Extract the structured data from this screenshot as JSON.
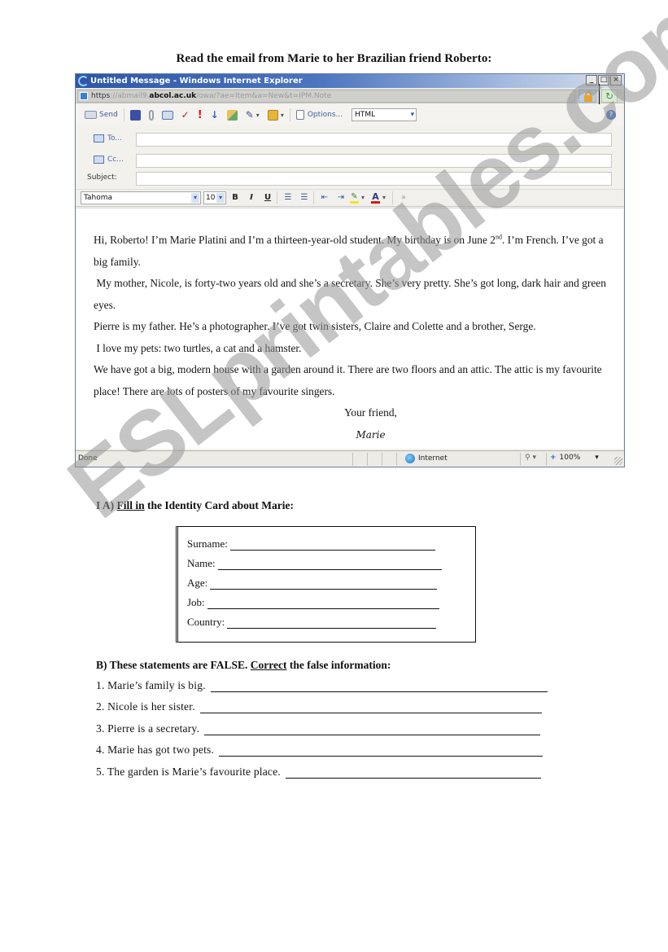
{
  "page_title": "Read the email from Marie to her Brazilian friend Roberto:",
  "browser": {
    "title": "Untitled Message - Windows Internet Explorer",
    "window_buttons": [
      "_",
      "□",
      "×"
    ],
    "address": {
      "scheme": "https",
      "prefix": "://abmail9.",
      "host": "abcol.ac.uk",
      "path": "/owa/?ae=Item&a=New&t=IPM.Note"
    },
    "refresh_glyph": "↻",
    "help_glyph": "?",
    "toolbar": {
      "send_label": "Send",
      "options_label": "Options...",
      "format_value": "HTML",
      "icons": [
        "save-icon",
        "attach-icon",
        "address-book-icon",
        "check-names-icon",
        "high-importance-icon",
        "low-importance-icon",
        "paste-icon",
        "spelling-icon",
        "flag-icon",
        "options-icon"
      ]
    },
    "header_fields": {
      "to_label": "To...",
      "cc_label": "Cc...",
      "subject_label": "Subject:",
      "to_value": "",
      "cc_value": "",
      "subject_value": ""
    },
    "format_bar": {
      "font": "Tahoma",
      "size": "10",
      "bold": "B",
      "italic": "I",
      "underline": "U",
      "bullets": "☰",
      "numbers": "☰",
      "outdent": "⇤",
      "indent": "⇥",
      "highlight": "✎",
      "font_color": "A",
      "more": "»"
    },
    "body": {
      "p1_a": "Hi, Roberto! I’m Marie Platini and I’m a thirteen-year-old student. My birthday is on June 2",
      "p1_sup": "nd",
      "p1_b": ". I’m French. I’ve got a big family.",
      "p2": "My mother, Nicole, is forty-two years old and she’s a secretary. She’s very pretty. She’s got long, dark hair and green eyes.",
      "p3": "Pierre is my father. He’s a photographer. I’ve got twin sisters, Claire and Colette and a brother, Serge.",
      "p4": "I love my pets: two turtles, a cat and a hamster.",
      "p5": "We have got a big, modern house with a garden around it. There are two floors and an attic. The attic is my favourite place! There are lots of posters of my favourite singers.",
      "closing": "Your friend,",
      "signature": "Marie"
    },
    "status": {
      "text": "Done",
      "zone": "Internet",
      "zoom": "100%",
      "caret": "▾"
    }
  },
  "exercise_a": {
    "prefix": "I A) ",
    "underlined": "Fill in",
    "suffix": " the Identity Card about Marie:",
    "fields": [
      "Surname:",
      "Name:",
      "Age:",
      "Job:",
      "Country:"
    ]
  },
  "exercise_b": {
    "prefix": "B) These statements are FALSE. ",
    "underlined": "Correct",
    "suffix": " the false information:",
    "statements": [
      "1. Marie’s family is big.",
      "2. Nicole is her sister.",
      "3. Pierre is a secretary.",
      "4. Marie has got two pets.",
      "5. The garden is Marie’s favourite place."
    ]
  },
  "watermark": "ESLprintables.com"
}
